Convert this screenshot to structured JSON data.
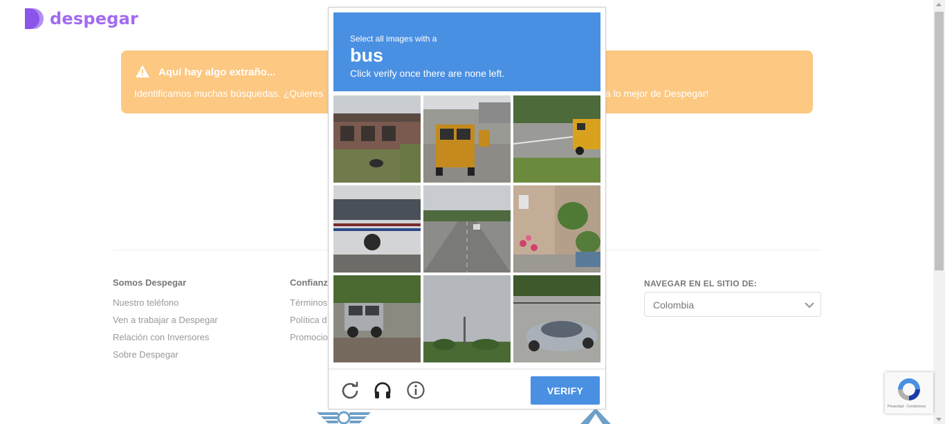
{
  "brand": {
    "name": "despegar",
    "color": "#a26bf1"
  },
  "alert": {
    "title": "Aquí hay algo extraño...",
    "body_left": "Identificamos muchas búsquedas. ¿Quieres",
    "body_right": "a lo mejor de Despegar!",
    "color": "#fcc882"
  },
  "footer": {
    "col1": {
      "title": "Somos Despegar",
      "links": [
        "Nuestro teléfono",
        "Ven a trabajar a Despegar",
        "Relación con Inversores",
        "Sobre Despegar"
      ]
    },
    "col2": {
      "title": "Confianz",
      "links": [
        "Términos",
        "Política d",
        "Promocio"
      ]
    },
    "nav": {
      "title": "NAVEGAR EN EL SITIO DE:",
      "selected": "Colombia"
    }
  },
  "captcha": {
    "instruction": "Select all images with a",
    "target": "bus",
    "subtext": "Click verify once there are none left.",
    "verify_label": "VERIFY",
    "accent": "#4a90e2",
    "tiles": [
      {
        "name": "tile-storefront"
      },
      {
        "name": "tile-school-bus-rear"
      },
      {
        "name": "tile-school-bus-side"
      },
      {
        "name": "tile-city-bus"
      },
      {
        "name": "tile-highway"
      },
      {
        "name": "tile-flowers-building"
      },
      {
        "name": "tile-suv"
      },
      {
        "name": "tile-treeline"
      },
      {
        "name": "tile-silver-car"
      }
    ]
  },
  "recaptcha_badge": {
    "text": "Privacidad - Condiciones"
  }
}
